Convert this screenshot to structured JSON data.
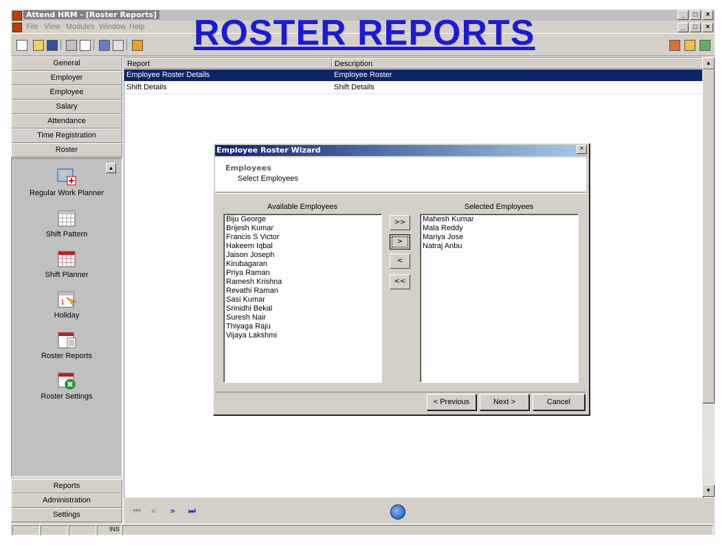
{
  "window": {
    "title": "Attend HRM - [Roster Reports]",
    "controls": [
      "_",
      "□",
      "×"
    ]
  },
  "menu": [
    "File",
    "View",
    "Modules",
    "Window",
    "Help"
  ],
  "banner": "ROSTER REPORTS",
  "sidebar": {
    "modules_top": [
      "General",
      "Employer",
      "Employee",
      "Salary",
      "Attendance",
      "Time Registration",
      "Roster"
    ],
    "roster_items": [
      {
        "label": "Regular Work Planner",
        "icon": "work-planner-icon"
      },
      {
        "label": "Shift Pattern",
        "icon": "calendar-icon"
      },
      {
        "label": "Shift Planner",
        "icon": "calendar-grid-icon"
      },
      {
        "label": "Holiday",
        "icon": "holiday-calendar-icon"
      },
      {
        "label": "Roster Reports",
        "icon": "report-calendar-icon"
      },
      {
        "label": "Roster Settings",
        "icon": "settings-calendar-icon"
      }
    ],
    "modules_bottom": [
      "Reports",
      "Administration",
      "Settings"
    ]
  },
  "grid": {
    "columns": [
      "Report",
      "Description"
    ],
    "rows": [
      {
        "report": "Employee Roster Details",
        "description": "Employee Roster",
        "selected": true
      },
      {
        "report": "Shift Details",
        "description": "Shift Details",
        "selected": false
      }
    ]
  },
  "navbar": [
    "⏮",
    "«",
    "»",
    "⏭"
  ],
  "statusbar": {
    "ins": "INS"
  },
  "dialog": {
    "title": "Employee Roster Wizard",
    "close": "×",
    "step_title": "Employees",
    "step_desc": "Select Employees",
    "available_label": "Available Employees",
    "selected_label": "Selected Employees",
    "available": [
      "Biju George",
      "Brijesh Kumar",
      "Francis S  Victor",
      "Hakeem Iqbal",
      "Jaison Joseph",
      "Kirubagaran",
      "Priya Raman",
      "Ramesh Krishna",
      "Revathi Raman",
      "Sasi Kumar",
      "Srinidhi Bekal",
      "Suresh Nair",
      "Thiyaga Raju",
      "Vijaya  Lakshmi"
    ],
    "selected": [
      "Mahesh Kumar",
      "Mala Reddy",
      "Mariya Jose",
      "Natraj Anbu"
    ],
    "move_buttons": [
      ">>",
      ">",
      "<",
      "<<"
    ],
    "buttons": {
      "previous": "< Previous",
      "next": "Next >",
      "cancel": "Cancel"
    }
  }
}
